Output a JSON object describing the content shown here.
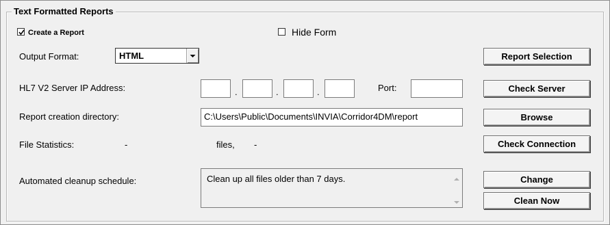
{
  "group_title": "Text Formatted Reports",
  "create_report": {
    "label": "Create a Report",
    "checked": true
  },
  "hide_form": {
    "label": "Hide Form",
    "checked": false
  },
  "output_format": {
    "label": "Output Format:",
    "value": "HTML"
  },
  "server_ip": {
    "label": "HL7 V2 Server IP Address:",
    "octets": [
      "",
      "",
      "",
      ""
    ],
    "port_label": "Port:",
    "port_value": ""
  },
  "report_dir": {
    "label": "Report creation directory:",
    "value": "C:\\Users\\Public\\Documents\\INVIA\\Corridor4DM\\report"
  },
  "file_stats": {
    "label": "File Statistics:",
    "count": "-",
    "files_label": "files,",
    "size": "-"
  },
  "cleanup": {
    "label": "Automated cleanup schedule:",
    "text": "Clean up all files older than 7 days."
  },
  "buttons": {
    "report_selection": "Report Selection",
    "check_server": "Check Server",
    "browse": "Browse",
    "check_connection": "Check Connection",
    "change": "Change",
    "clean_now": "Clean Now"
  },
  "icons": [
    "checkmark-icon",
    "chevron-down-icon",
    "scroll-up-icon",
    "scroll-down-icon"
  ]
}
